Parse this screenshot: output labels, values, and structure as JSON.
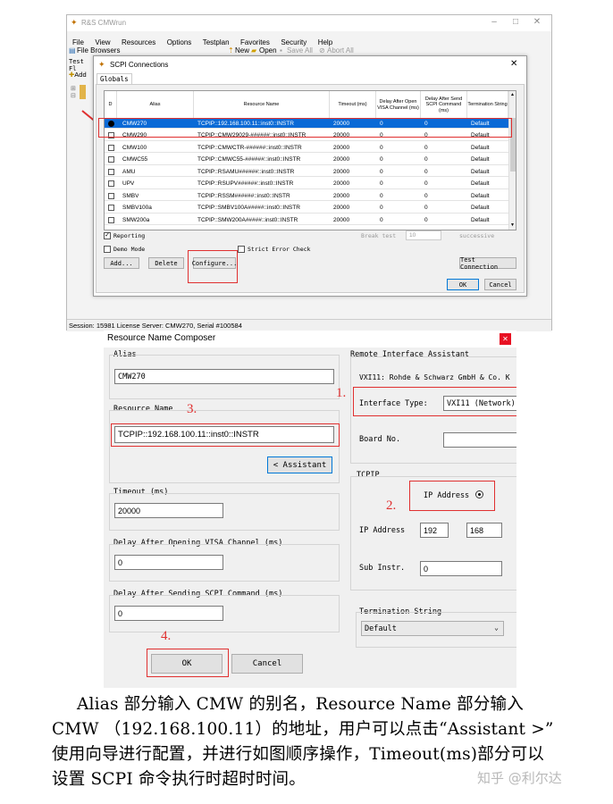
{
  "main_window": {
    "title": "R&S CMWrun",
    "menu": [
      "File",
      "View",
      "Resources",
      "Options",
      "Testplan",
      "Favorites",
      "Security",
      "Help"
    ],
    "toolbar": {
      "file_browsers": "File Browsers",
      "new": "New",
      "open": "Open",
      "save_all": "Save All",
      "abort_all": "Abort All"
    },
    "side": {
      "test": "Test Fl",
      "add": "Add"
    },
    "status": "Session:  15981     License Server:  CMW270, Serial #100584"
  },
  "scpi_dialog": {
    "title": "SCPI Connections",
    "tab": "Globals",
    "columns": [
      "D",
      "Alias",
      "Resource Name",
      "Timeout (ms)",
      "Delay After Open VISA Channel (ms)",
      "Delay After Send SCPI Command (ms)",
      "Termination String"
    ],
    "rows": [
      {
        "alias": "CMW270",
        "resource": "TCPIP::192.168.100.11::inst0::INSTR",
        "timeout": "20000",
        "d1": "0",
        "d2": "0",
        "term": "Default",
        "selected": true
      },
      {
        "alias": "CMW290",
        "resource": "TCPIP::CMW29029-######::inst0::INSTR",
        "timeout": "20000",
        "d1": "0",
        "d2": "0",
        "term": "Default"
      },
      {
        "alias": "CMW100",
        "resource": "TCPIP::CMWCTR-######::inst0::INSTR",
        "timeout": "20000",
        "d1": "0",
        "d2": "0",
        "term": "Default"
      },
      {
        "alias": "CMWC55",
        "resource": "TCPIP::CMWC55-######::inst0::INSTR",
        "timeout": "20000",
        "d1": "0",
        "d2": "0",
        "term": "Default"
      },
      {
        "alias": "AMU",
        "resource": "TCPIP::RSAMU######::inst0::INSTR",
        "timeout": "20000",
        "d1": "0",
        "d2": "0",
        "term": "Default"
      },
      {
        "alias": "UPV",
        "resource": "TCPIP::RSUPV######::inst0::INSTR",
        "timeout": "20000",
        "d1": "0",
        "d2": "0",
        "term": "Default"
      },
      {
        "alias": "SMBV",
        "resource": "TCPIP::RSSM######::inst0::INSTR",
        "timeout": "20000",
        "d1": "0",
        "d2": "0",
        "term": "Default"
      },
      {
        "alias": "SMBV100a",
        "resource": "TCPIP::SMBV100A#####::inst0::INSTR",
        "timeout": "20000",
        "d1": "0",
        "d2": "0",
        "term": "Default"
      },
      {
        "alias": "SMW200a",
        "resource": "TCPIP::SMW200A#####::inst0::INSTR",
        "timeout": "20000",
        "d1": "0",
        "d2": "0",
        "term": "Default"
      }
    ],
    "reporting": "Reporting",
    "break_test": "Break test",
    "break_value": "10",
    "successive": "successive",
    "demo_mode": "Demo Mode",
    "strict_error": "Strict Error Check",
    "buttons": {
      "add": "Add...",
      "delete": "Delete",
      "configure": "Configure...",
      "test_connection": "Test Connection",
      "ok": "OK",
      "cancel": "Cancel"
    }
  },
  "composer": {
    "title": "Resource Name Composer",
    "alias_label": "Alias",
    "alias_value": "CMW270",
    "resource_label": "Resource Name",
    "resource_value": "TCPIP::192.168.100.11::inst0::INSTR",
    "assistant_button": "< Assistant",
    "timeout_label": "Timeout (ms)",
    "timeout_value": "20000",
    "delay_open_label": "Delay After Opening VISA Channel (ms)",
    "delay_open_value": "0",
    "delay_send_label": "Delay After Sending SCPI Command (ms)",
    "delay_send_value": "0",
    "ok": "OK",
    "cancel": "Cancel",
    "remote_label": "Remote Interface Assistant",
    "vendor": "VXI11: Rohde & Schwarz GmbH & Co. K",
    "interface_type_label": "Interface Type:",
    "interface_type_value": "VXI11 (Network)",
    "board_no_label": "Board No.",
    "tcpip_label": "TCPIP",
    "ip_address_radio": "IP Address",
    "ip_address_label": "IP Address",
    "ip_part1": "192",
    "ip_part2": "168",
    "sub_instr_label": "Sub Instr.",
    "sub_instr_value": "0",
    "termination_label": "Termination String",
    "termination_value": "Default",
    "markers": {
      "m1": "1.",
      "m2": "2.",
      "m3": "3.",
      "m4": "4."
    }
  },
  "caption": {
    "line1": "Alias 部分输入 CMW 的别名，Resource Name 部分输入",
    "line2": "CMW （192.168.100.11）的地址，用户可以点击“Assistant >”",
    "line3": "使用向导进行配置，并进行如图顺序操作，Timeout(ms)部分可以",
    "line4": "设置 SCPI 命令执行时超时时间。"
  },
  "watermark": "知乎 @利尔达"
}
